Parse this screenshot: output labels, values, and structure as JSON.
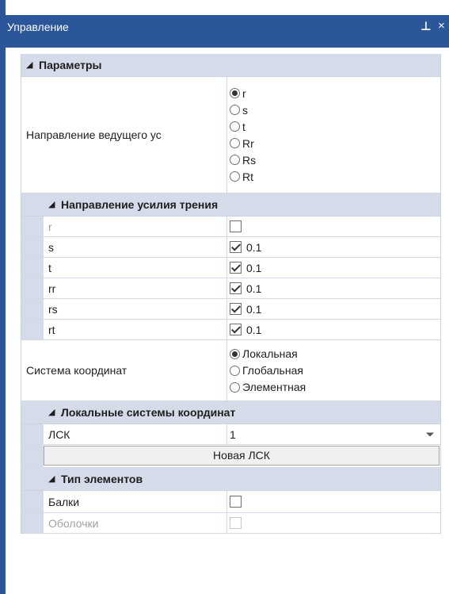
{
  "window": {
    "title": "Управление",
    "pin_glyph": "⊥",
    "close_glyph": "×",
    "accent_color": "#2b579a"
  },
  "params": {
    "header": "Параметры",
    "lead_dir": {
      "label": "Направление ведущего ус",
      "options": [
        "r",
        "s",
        "t",
        "Rr",
        "Rs",
        "Rt"
      ],
      "selected": "r"
    }
  },
  "friction": {
    "header": "Направление усилия трения",
    "rows": [
      {
        "label": "r",
        "checked": false,
        "value": "",
        "disabled": true
      },
      {
        "label": "s",
        "checked": true,
        "value": "0.1",
        "disabled": false
      },
      {
        "label": "t",
        "checked": true,
        "value": "0.1",
        "disabled": false
      },
      {
        "label": "rr",
        "checked": true,
        "value": "0.1",
        "disabled": false
      },
      {
        "label": "rs",
        "checked": true,
        "value": "0.1",
        "disabled": false
      },
      {
        "label": "rt",
        "checked": true,
        "value": "0.1",
        "disabled": false
      }
    ]
  },
  "coord_system": {
    "label": "Система координат",
    "options": [
      "Локальная",
      "Глобальная",
      "Элементная"
    ],
    "selected": "Локальная"
  },
  "local_cs": {
    "header": "Локальные системы координат",
    "lsk_label": "ЛСК",
    "lsk_value": "1",
    "new_button": "Новая ЛСК"
  },
  "elem_type": {
    "header": "Тип элементов",
    "rows": [
      {
        "label": "Балки",
        "checked": false,
        "disabled": false
      },
      {
        "label": "Оболочки",
        "checked": false,
        "disabled": true
      }
    ]
  }
}
